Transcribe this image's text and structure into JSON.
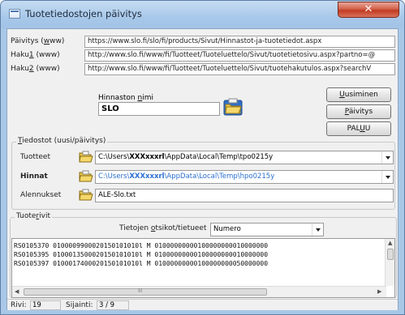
{
  "window": {
    "title": "Tuotetiedostojen päivitys",
    "close_glyph": "✕"
  },
  "urls": {
    "paivitys": {
      "label_pre": "Päivitys (",
      "label_u": "w",
      "label_post": "ww)",
      "value": "https://www.slo.fi/slo/fi/products/Sivut/Hinnastot-ja-tuotetiedot.aspx"
    },
    "haku1": {
      "label_pre": "Haku",
      "label_u": "1",
      "label_post": " (www)",
      "value": "http://www.slo.fi/www/fi/Tuotteet/Tuoteluettelo/Sivut/tuotetietosivu.aspx?partno=@"
    },
    "haku2": {
      "label_pre": "Haku",
      "label_u": "2",
      "label_post": " (www)",
      "value": "http://www.slo.fi/www/fi/Tuotteet/Tuoteluettelo/Sivut/tuotehakutulos.aspx?searchV"
    }
  },
  "hinnasto": {
    "label_pre": "Hinnaston ",
    "label_u": "n",
    "label_post": "imi",
    "value": "SLO"
  },
  "buttons": {
    "uusiminen_pre": "",
    "uusiminen_u": "U",
    "uusiminen_post": "usiminen",
    "paivitys_pre": "",
    "paivitys_u": "P",
    "paivitys_post": "äivitys",
    "paluu_pre": "PAL",
    "paluu_u": "U",
    "paluu_post": "U"
  },
  "tiedostot": {
    "title_pre": "",
    "title_u": "T",
    "title_post": "iedostot (uusi/päivitys)",
    "tuotteet": {
      "label": "Tuotteet",
      "path_pre": "C:\\Users\\",
      "path_user": "XXXxxxrl",
      "path_post": "\\AppData\\Local\\Temp\\tpo0215y"
    },
    "hinnat": {
      "label": "Hinnat",
      "path_pre": "C:\\Users\\",
      "path_user": "XXXxxxrl",
      "path_post": "\\AppData\\Local\\Temp\\hpo0215y"
    },
    "alennukset": {
      "label": "Alennukset",
      "value": "ALE-Slo.txt"
    }
  },
  "tuoterivit": {
    "title_pre": "Tuote",
    "title_u": "r",
    "title_post": "ivit",
    "ot_label_pre": "Tietojen ",
    "ot_label_u": "o",
    "ot_label_post": "tsikot/tietueet",
    "ot_value": "Numero",
    "rows": [
      "RS0105370  0100009900020150101010l  M  01000000000100000000010000000",
      "RS0105395  0100013500020150101010l  M  01000000000100000000010000000",
      "RS0105397  0100017400020150101010l  M  01000000000100000000050000000"
    ],
    "scroll_dots": "III"
  },
  "status": {
    "rivi_label": "Rivi:",
    "rivi_value": "19",
    "sijainti_label": "Sijainti:",
    "sijainti_value": "3 / 9"
  },
  "colors": {
    "title_gradient_top": "#c6dcf2",
    "close_red": "#c13b22",
    "folder_yellow": "#e8c64a",
    "hinnat_path_blue": "#2a6fd0"
  }
}
